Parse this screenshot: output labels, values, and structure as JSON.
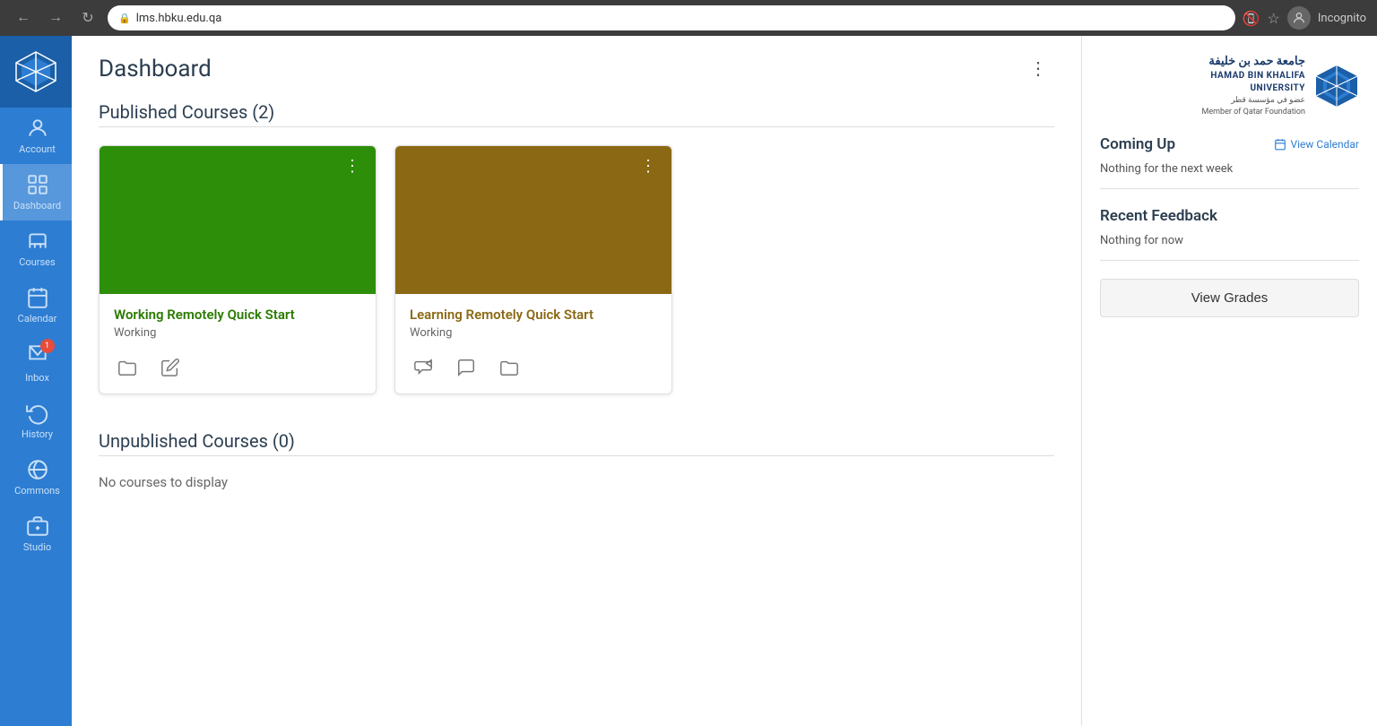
{
  "browser": {
    "url": "lms.hbku.edu.qa",
    "user": "Incognito"
  },
  "sidebar": {
    "items": [
      {
        "id": "account",
        "label": "Account",
        "icon": "person"
      },
      {
        "id": "dashboard",
        "label": "Dashboard",
        "icon": "dashboard"
      },
      {
        "id": "courses",
        "label": "Courses",
        "icon": "courses"
      },
      {
        "id": "calendar",
        "label": "Calendar",
        "icon": "calendar"
      },
      {
        "id": "inbox",
        "label": "Inbox",
        "icon": "inbox",
        "badge": "1"
      },
      {
        "id": "history",
        "label": "History",
        "icon": "history"
      },
      {
        "id": "commons",
        "label": "Commons",
        "icon": "commons"
      },
      {
        "id": "studio",
        "label": "Studio",
        "icon": "studio"
      }
    ]
  },
  "main": {
    "title": "Dashboard",
    "published_section": "Published Courses (2)",
    "unpublished_section": "Unpublished Courses (0)",
    "no_courses_text": "No courses to display",
    "courses": [
      {
        "id": "course-1",
        "name": "Working Remotely Quick Start",
        "status": "Working",
        "color": "green",
        "icons": [
          "folder",
          "edit"
        ]
      },
      {
        "id": "course-2",
        "name": "Learning Remotely Quick Start",
        "status": "Working",
        "color": "brown",
        "icons": [
          "announce",
          "discussion",
          "folder"
        ]
      }
    ]
  },
  "right_panel": {
    "university": {
      "name": "جامعة حمد بن خليفة",
      "name_en": "HAMAD BIN KHALIFA UNIVERSITY",
      "subtitle": "عضو في مؤسسة قطر",
      "subtitle_en": "Member of Qatar Foundation"
    },
    "coming_up": {
      "title": "Coming Up",
      "view_calendar": "View Calendar",
      "nothing_text": "Nothing for the next week"
    },
    "recent_feedback": {
      "title": "Recent Feedback",
      "nothing_text": "Nothing for now"
    },
    "view_grades_label": "View Grades"
  }
}
